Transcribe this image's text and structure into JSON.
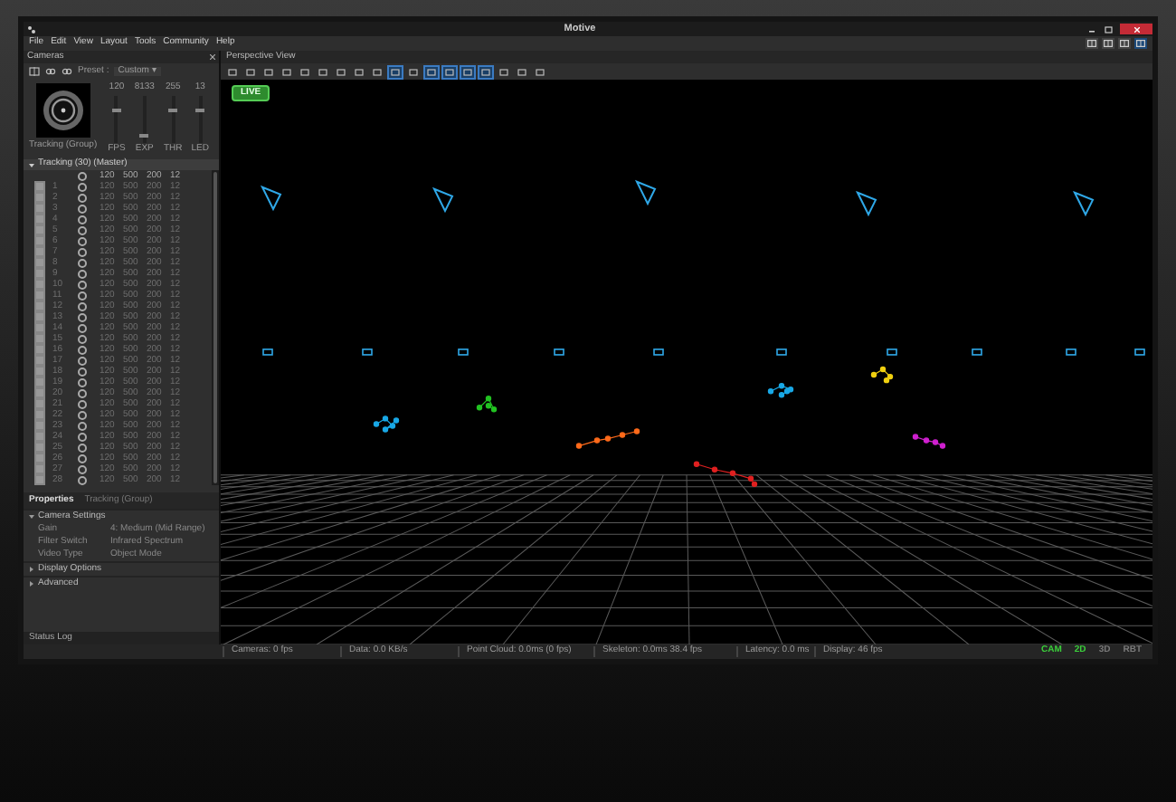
{
  "window": {
    "title": "Motive"
  },
  "menu": [
    "File",
    "Edit",
    "View",
    "Layout",
    "Tools",
    "Community",
    "Help"
  ],
  "cameras_panel": {
    "title": "Cameras",
    "preset_label": "Preset :",
    "preset_value": "Custom ▾",
    "preview_label": "Tracking (Group)",
    "sliders": [
      {
        "value": "120",
        "label": "FPS",
        "level": 0.7
      },
      {
        "value": "8133",
        "label": "EXP",
        "level": 0.1
      },
      {
        "value": "255",
        "label": "THR",
        "level": 0.7
      },
      {
        "value": "13",
        "label": "LED",
        "level": 0.7
      }
    ]
  },
  "camera_group": {
    "title": "Tracking (30) (Master)",
    "expanded": true,
    "columns": [
      "120",
      "500",
      "200",
      "12"
    ],
    "rows": [
      {
        "number": "1",
        "checked": true,
        "values": [
          "120",
          "500",
          "200",
          "12"
        ]
      },
      {
        "number": "2",
        "checked": true,
        "values": [
          "120",
          "500",
          "200",
          "12"
        ]
      },
      {
        "number": "3",
        "checked": true,
        "values": [
          "120",
          "500",
          "200",
          "12"
        ]
      },
      {
        "number": "4",
        "checked": true,
        "values": [
          "120",
          "500",
          "200",
          "12"
        ]
      },
      {
        "number": "5",
        "checked": true,
        "values": [
          "120",
          "500",
          "200",
          "12"
        ]
      },
      {
        "number": "6",
        "checked": true,
        "values": [
          "120",
          "500",
          "200",
          "12"
        ]
      },
      {
        "number": "7",
        "checked": true,
        "values": [
          "120",
          "500",
          "200",
          "12"
        ]
      },
      {
        "number": "8",
        "checked": true,
        "values": [
          "120",
          "500",
          "200",
          "12"
        ]
      },
      {
        "number": "9",
        "checked": true,
        "values": [
          "120",
          "500",
          "200",
          "12"
        ]
      },
      {
        "number": "10",
        "checked": true,
        "values": [
          "120",
          "500",
          "200",
          "12"
        ]
      },
      {
        "number": "11",
        "checked": true,
        "values": [
          "120",
          "500",
          "200",
          "12"
        ]
      },
      {
        "number": "12",
        "checked": true,
        "values": [
          "120",
          "500",
          "200",
          "12"
        ]
      },
      {
        "number": "13",
        "checked": true,
        "values": [
          "120",
          "500",
          "200",
          "12"
        ]
      },
      {
        "number": "14",
        "checked": true,
        "values": [
          "120",
          "500",
          "200",
          "12"
        ]
      },
      {
        "number": "15",
        "checked": true,
        "values": [
          "120",
          "500",
          "200",
          "12"
        ]
      },
      {
        "number": "16",
        "checked": true,
        "values": [
          "120",
          "500",
          "200",
          "12"
        ]
      },
      {
        "number": "17",
        "checked": true,
        "values": [
          "120",
          "500",
          "200",
          "12"
        ]
      },
      {
        "number": "18",
        "checked": true,
        "values": [
          "120",
          "500",
          "200",
          "12"
        ]
      },
      {
        "number": "19",
        "checked": true,
        "values": [
          "120",
          "500",
          "200",
          "12"
        ]
      },
      {
        "number": "20",
        "checked": true,
        "values": [
          "120",
          "500",
          "200",
          "12"
        ]
      },
      {
        "number": "21",
        "checked": true,
        "values": [
          "120",
          "500",
          "200",
          "12"
        ]
      },
      {
        "number": "22",
        "checked": true,
        "values": [
          "120",
          "500",
          "200",
          "12"
        ]
      },
      {
        "number": "23",
        "checked": true,
        "values": [
          "120",
          "500",
          "200",
          "12"
        ]
      },
      {
        "number": "24",
        "checked": true,
        "values": [
          "120",
          "500",
          "200",
          "12"
        ]
      },
      {
        "number": "25",
        "checked": true,
        "values": [
          "120",
          "500",
          "200",
          "12"
        ]
      },
      {
        "number": "26",
        "checked": true,
        "values": [
          "120",
          "500",
          "200",
          "12"
        ]
      },
      {
        "number": "27",
        "checked": true,
        "values": [
          "120",
          "500",
          "200",
          "12"
        ]
      },
      {
        "number": "28",
        "checked": true,
        "values": [
          "120",
          "500",
          "200",
          "12"
        ]
      }
    ]
  },
  "properties": {
    "tabs": [
      {
        "label": "Properties",
        "selected": true
      },
      {
        "label": "Tracking (Group)",
        "selected": false
      }
    ],
    "sections": [
      {
        "title": "Camera Settings",
        "expanded": true,
        "rows": [
          {
            "label": "Gain",
            "value": "4: Medium (Mid Range)"
          },
          {
            "label": "Filter Switch",
            "value": "Infrared Spectrum"
          },
          {
            "label": "Video Type",
            "value": "Object Mode"
          }
        ]
      },
      {
        "title": "Display Options",
        "expanded": false
      },
      {
        "title": "Advanced",
        "expanded": false
      }
    ]
  },
  "status_log": "Status Log",
  "viewport": {
    "title": "Perspective View",
    "live_badge": "LIVE"
  },
  "status_bar": {
    "items": [
      "Cameras: 0 fps",
      "Data: 0.0 KB/s",
      "Point Cloud: 0.0ms (0 fps)",
      "Skeleton: 0.0ms 38.4 fps",
      "Latency: 0.0 ms",
      "Display: 46 fps"
    ],
    "indicators": [
      {
        "label": "CAM",
        "on": true
      },
      {
        "label": "2D",
        "on": true
      },
      {
        "label": "3D",
        "on": false
      },
      {
        "label": "RBT",
        "on": false
      }
    ]
  }
}
